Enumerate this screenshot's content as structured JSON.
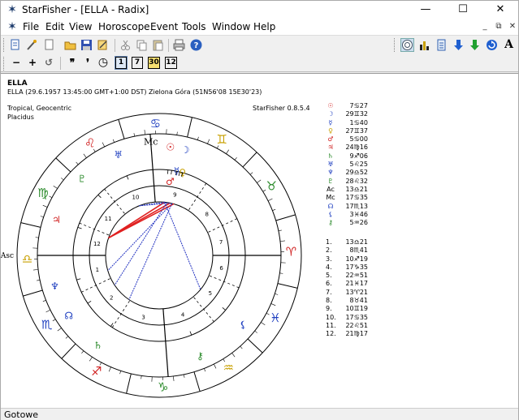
{
  "window": {
    "title": "StarFisher - [ELLA - Radix]",
    "app_icon": "star-icon",
    "minimize": "—",
    "maximize": "☐",
    "close": "✕"
  },
  "menu": {
    "items": [
      "File",
      "Edit",
      "View",
      "Horoscope",
      "Event",
      "Tools",
      "Window",
      "Help"
    ],
    "mdi_minimize": "_",
    "mdi_restore": "⧉",
    "mdi_close": "✕"
  },
  "toolbar2": {
    "zoom_out": "−",
    "zoom_in": "+",
    "undo": "↺",
    "back_fast": "❞",
    "back": "❜",
    "clock": "◷",
    "step1": "1",
    "step7": "7",
    "step30": "30",
    "step12": "12"
  },
  "chart": {
    "name": "ELLA",
    "details": "ELLA (29.6.1957 13:45:00 GMT+1:00 DST) Zielona Góra (51N56'08 15E30'23)",
    "zodiac": "Tropical, Geocentric",
    "house_system": "Placidus",
    "version": "StarFisher 0.8.5.4",
    "asc_label": "Asc",
    "mc_label": "Mc",
    "signs": [
      "♈",
      "♉",
      "♊",
      "♋",
      "♌",
      "♍",
      "♎",
      "♏",
      "♐",
      "♑",
      "♒",
      "♓"
    ],
    "house_numbers": [
      "1",
      "2",
      "3",
      "4",
      "5",
      "6",
      "7",
      "8",
      "9",
      "10",
      "11",
      "12"
    ]
  },
  "planets": [
    {
      "symbol": "☉",
      "value": "7♋27",
      "color": "#d02020"
    },
    {
      "symbol": "☽",
      "value": "29♊32",
      "color": "#2040c0"
    },
    {
      "symbol": "☿",
      "value": "1♋40",
      "color": "#2040c0"
    },
    {
      "symbol": "♀",
      "value": "27♊37",
      "color": "#c8a000"
    },
    {
      "symbol": "♂",
      "value": "5♋00",
      "color": "#d02020"
    },
    {
      "symbol": "♃",
      "value": "24♍16",
      "color": "#d02020"
    },
    {
      "symbol": "♄",
      "value": "9♐06",
      "color": "#2a8a2a"
    },
    {
      "symbol": "♅",
      "value": "5♌25",
      "color": "#2040c0"
    },
    {
      "symbol": "♆",
      "value": "29♎52",
      "color": "#2040c0"
    },
    {
      "symbol": "♇",
      "value": "28♌32",
      "color": "#2a8a2a"
    },
    {
      "symbol": "Ac",
      "value": "13♎21",
      "color": "#000000"
    },
    {
      "symbol": "Mc",
      "value": "17♋35",
      "color": "#000000"
    },
    {
      "symbol": "☊",
      "value": "17♏13",
      "color": "#2040c0"
    },
    {
      "symbol": "⚸",
      "value": "3♓46",
      "color": "#2040c0"
    },
    {
      "symbol": "⚷",
      "value": "5♒26",
      "color": "#2a8a2a"
    }
  ],
  "houses": [
    {
      "num": "1.",
      "value": "13♎21"
    },
    {
      "num": "2.",
      "value": "8♏41"
    },
    {
      "num": "3.",
      "value": "10♐19"
    },
    {
      "num": "4.",
      "value": "17♑35"
    },
    {
      "num": "5.",
      "value": "22♒51"
    },
    {
      "num": "6.",
      "value": "21♓17"
    },
    {
      "num": "7.",
      "value": "13♈21"
    },
    {
      "num": "8.",
      "value": "8♉41"
    },
    {
      "num": "9.",
      "value": "10♊19"
    },
    {
      "num": "10.",
      "value": "17♋35"
    },
    {
      "num": "11.",
      "value": "22♌51"
    },
    {
      "num": "12.",
      "value": "21♍17"
    }
  ],
  "status": {
    "text": "Gotowe"
  },
  "colors": {
    "fire": "#d02020",
    "water": "#2040c0",
    "earth": "#2a8a2a",
    "air": "#c8a000",
    "aspect_hard": "#e02020",
    "aspect_soft": "#2030c0"
  }
}
